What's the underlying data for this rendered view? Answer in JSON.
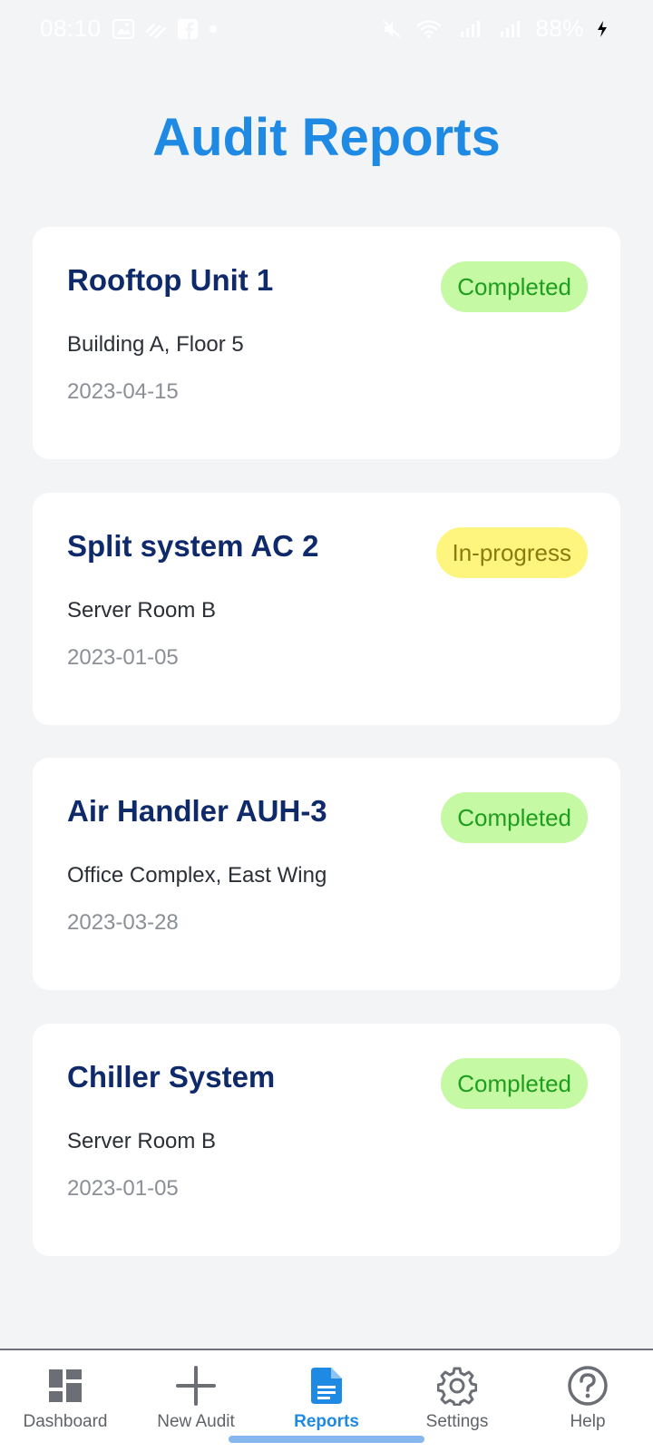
{
  "status_bar": {
    "time": "08:10",
    "battery": "88%"
  },
  "page": {
    "title": "Audit Reports"
  },
  "reports": [
    {
      "title": "Rooftop Unit 1",
      "location": "Building A, Floor 5",
      "date": "2023-04-15",
      "status": "Completed"
    },
    {
      "title": "Split system AC 2",
      "location": "Server Room B",
      "date": "2023-01-05",
      "status": "In-progress"
    },
    {
      "title": "Air Handler AUH-3",
      "location": "Office Complex, East Wing",
      "date": "2023-03-28",
      "status": "Completed"
    },
    {
      "title": "Chiller System",
      "location": "Server Room B",
      "date": "2023-01-05",
      "status": "Completed"
    }
  ],
  "status_colors": {
    "completed_bg": "#c6f9a3",
    "completed_text": "#1e9e1e",
    "in_progress_bg": "#fdf57d",
    "in_progress_text": "#8a7a10"
  },
  "bottom_nav": {
    "items": [
      {
        "label": "Dashboard",
        "icon": "dashboard-icon"
      },
      {
        "label": "New Audit",
        "icon": "plus-icon"
      },
      {
        "label": "Reports",
        "icon": "document-icon",
        "active": true
      },
      {
        "label": "Settings",
        "icon": "gear-icon"
      },
      {
        "label": "Help",
        "icon": "help-circle-icon"
      }
    ]
  },
  "colors": {
    "accent": "#1f8ae3",
    "title_text": "#0f2a6b",
    "background": "#f3f4f6"
  }
}
